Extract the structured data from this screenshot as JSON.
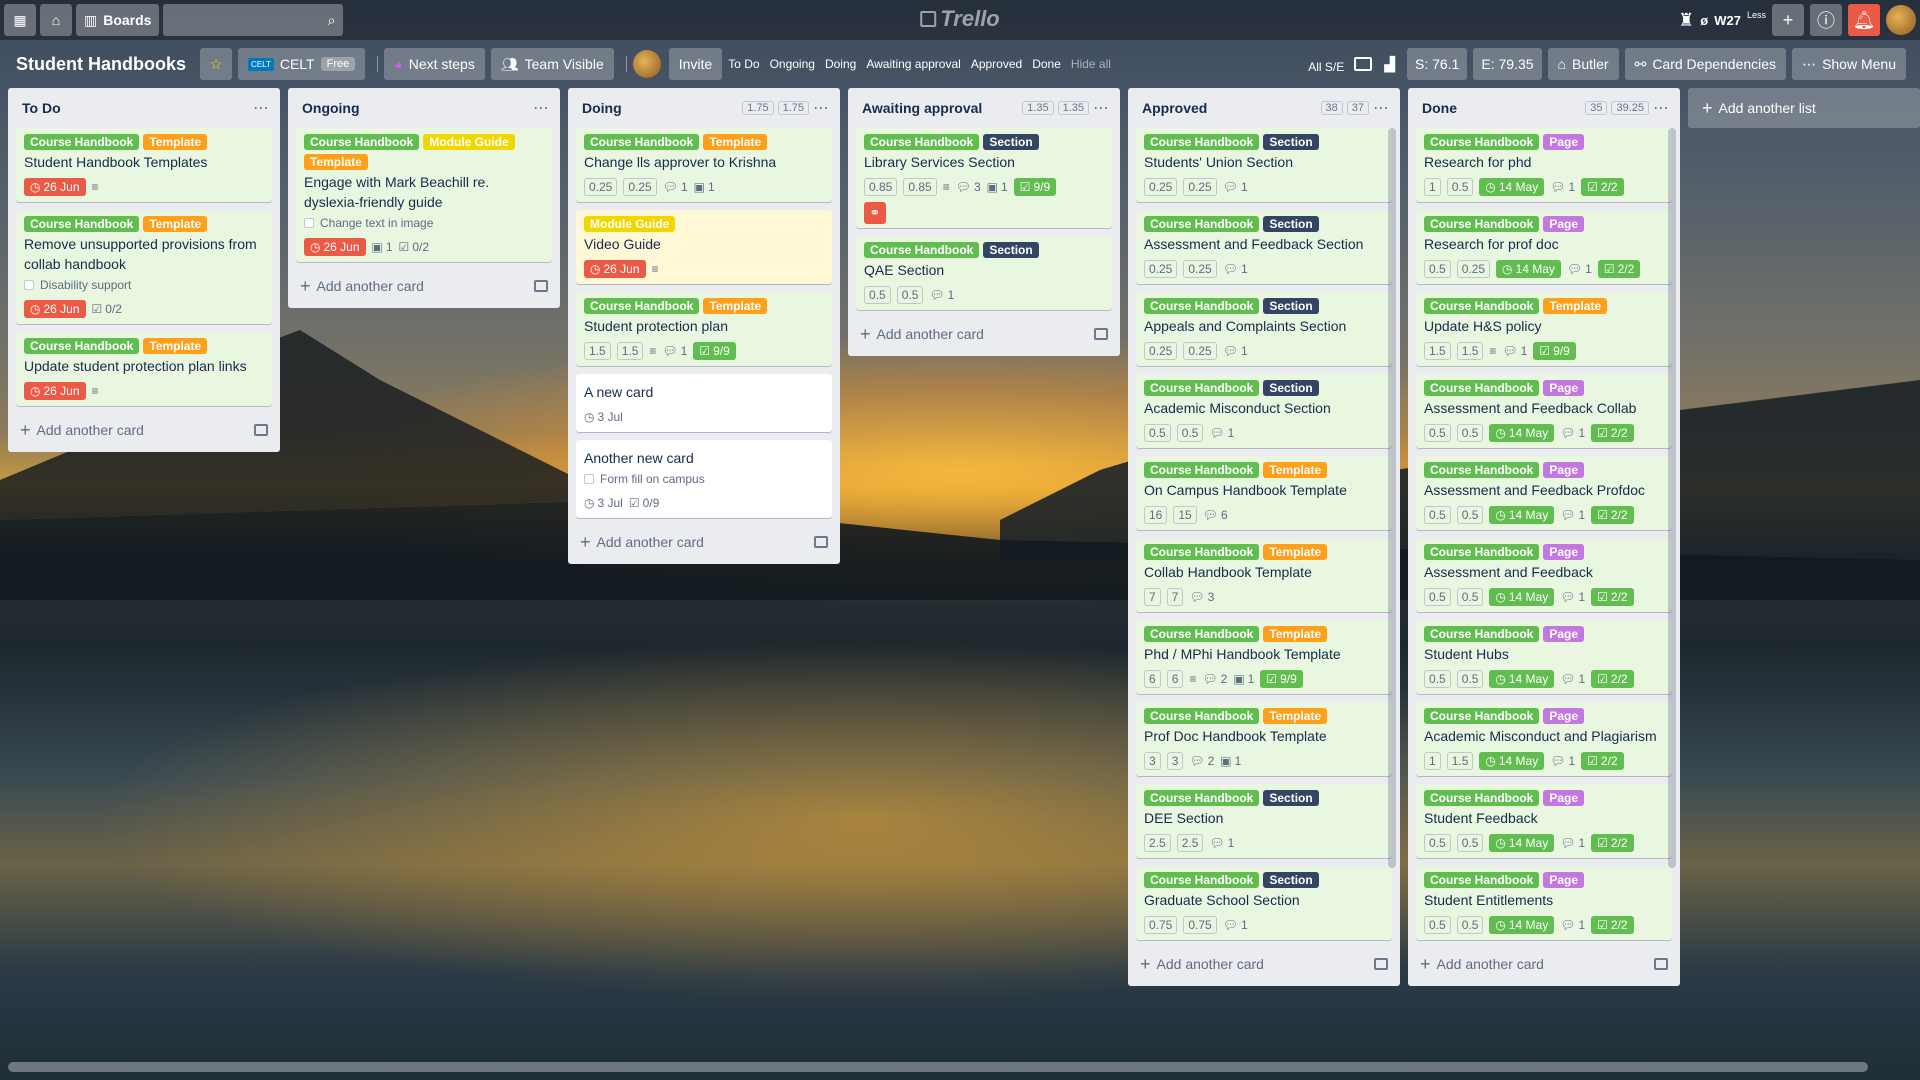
{
  "topnav": {
    "boards_label": "Boards",
    "logo_text": "Trello",
    "week": "W27",
    "week_sup": "Less",
    "slash": "ø"
  },
  "header": {
    "title": "Student Handbooks",
    "team": "CELT",
    "team_plan": "Free",
    "next_steps": "Next steps",
    "visibility": "Team Visible",
    "invite": "Invite",
    "quick_links": [
      "To Do",
      "Ongoing",
      "Doing",
      "Awaiting approval",
      "Approved",
      "Done"
    ],
    "hide_all": "Hide all",
    "all_se": "All S/E",
    "s_value": "S: 76.1",
    "e_value": "E: 79.35",
    "butler": "Butler",
    "card_deps": "Card Dependencies",
    "show_menu": "Show Menu"
  },
  "add_card_label": "Add another card",
  "add_list_label": "Add another list",
  "lists": {
    "todo": {
      "title": "To Do",
      "cards": [
        {
          "labels": [
            "Course Handbook",
            "Template"
          ],
          "title": "Student Handbook Templates",
          "due": "26 Jun"
        },
        {
          "labels": [
            "Course Handbook",
            "Template"
          ],
          "title": "Remove unsupported provisions from collab handbook",
          "checklist_item": "Disability support",
          "due": "26 Jun",
          "checklist": "0/2"
        },
        {
          "labels": [
            "Course Handbook",
            "Template"
          ],
          "title": "Update student protection plan links",
          "due": "26 Jun"
        }
      ]
    },
    "ongoing": {
      "title": "Ongoing",
      "cards": [
        {
          "labels": [
            "Course Handbook",
            "Module Guide",
            "Template"
          ],
          "title": "Engage with Mark Beachill re. dyslexia-friendly guide",
          "checklist_item": "Change text in image",
          "due": "26 Jun",
          "attachments": "1",
          "checklist": "0/2"
        }
      ]
    },
    "doing": {
      "title": "Doing",
      "s": "1.75",
      "e": "1.75",
      "cards": [
        {
          "labels": [
            "Course Handbook",
            "Template"
          ],
          "title": "Change lls approver to Krishna",
          "s": "0.25",
          "e": "0.25",
          "comments": "1",
          "attachments": "1"
        },
        {
          "labels": [
            "Module Guide"
          ],
          "title": "Video Guide",
          "due": "26 Jun"
        },
        {
          "labels": [
            "Course Handbook",
            "Template"
          ],
          "title": "Student protection plan",
          "s": "1.5",
          "e": "1.5",
          "comments": "1",
          "checklist": "9/9"
        },
        {
          "title": "A new card",
          "due": "3 Jul"
        },
        {
          "title": "Another new card",
          "checklist_item": "Form fill on campus",
          "due": "3 Jul",
          "checklist": "0/9"
        }
      ]
    },
    "awaiting": {
      "title": "Awaiting approval",
      "s": "1.35",
      "e": "1.35",
      "cards": [
        {
          "labels": [
            "Course Handbook",
            "Section"
          ],
          "title": "Library Services Section",
          "s": "0.85",
          "e": "0.85",
          "comments": "3",
          "attachments": "1",
          "checklist": "9/9"
        },
        {
          "labels": [
            "Course Handbook",
            "Section"
          ],
          "title": "QAE Section",
          "s": "0.5",
          "e": "0.5",
          "comments": "1"
        }
      ]
    },
    "approved": {
      "title": "Approved",
      "s": "38",
      "e": "37",
      "cards": [
        {
          "labels": [
            "Course Handbook",
            "Section"
          ],
          "title": "Students' Union Section",
          "s": "0.25",
          "e": "0.25",
          "comments": "1"
        },
        {
          "labels": [
            "Course Handbook",
            "Section"
          ],
          "title": "Assessment and Feedback Section",
          "s": "0.25",
          "e": "0.25",
          "comments": "1"
        },
        {
          "labels": [
            "Course Handbook",
            "Section"
          ],
          "title": "Appeals and Complaints Section",
          "s": "0.25",
          "e": "0.25",
          "comments": "1"
        },
        {
          "labels": [
            "Course Handbook",
            "Section"
          ],
          "title": "Academic Misconduct Section",
          "s": "0.5",
          "e": "0.5",
          "comments": "1"
        },
        {
          "labels": [
            "Course Handbook",
            "Template"
          ],
          "title": "On Campus Handbook Template",
          "s": "16",
          "e": "15",
          "comments": "6"
        },
        {
          "labels": [
            "Course Handbook",
            "Template"
          ],
          "title": "Collab Handbook Template",
          "s": "7",
          "e": "7",
          "comments": "3"
        },
        {
          "labels": [
            "Course Handbook",
            "Template"
          ],
          "title": "Phd / MPhi Handbook Template",
          "s": "6",
          "e": "6",
          "comments": "2",
          "attachments": "1",
          "checklist": "9/9"
        },
        {
          "labels": [
            "Course Handbook",
            "Template"
          ],
          "title": "Prof Doc Handbook Template",
          "s": "3",
          "e": "3",
          "comments": "2",
          "attachments": "1"
        },
        {
          "labels": [
            "Course Handbook",
            "Section"
          ],
          "title": "DEE Section",
          "s": "2.5",
          "e": "2.5",
          "comments": "1"
        },
        {
          "labels": [
            "Course Handbook",
            "Section"
          ],
          "title": "Graduate School Section",
          "s": "0.75",
          "e": "0.75",
          "comments": "1"
        }
      ]
    },
    "done": {
      "title": "Done",
      "s": "35",
      "e": "39.25",
      "cards": [
        {
          "labels": [
            "Course Handbook",
            "Page"
          ],
          "title": "Research for phd",
          "s": "1",
          "e": "0.5",
          "due": "14 May",
          "comments": "1",
          "checklist": "2/2"
        },
        {
          "labels": [
            "Course Handbook",
            "Page"
          ],
          "title": "Research for prof doc",
          "s": "0.5",
          "e": "0.25",
          "due": "14 May",
          "comments": "1",
          "checklist": "2/2"
        },
        {
          "labels": [
            "Course Handbook",
            "Template"
          ],
          "title": "Update H&S policy",
          "s": "1.5",
          "e": "1.5",
          "comments": "1",
          "checklist": "9/9"
        },
        {
          "labels": [
            "Course Handbook",
            "Page"
          ],
          "title": "Assessment and Feedback Collab",
          "s": "0.5",
          "e": "0.5",
          "due": "14 May",
          "comments": "1",
          "checklist": "2/2"
        },
        {
          "labels": [
            "Course Handbook",
            "Page"
          ],
          "title": "Assessment and Feedback Profdoc",
          "s": "0.5",
          "e": "0.5",
          "due": "14 May",
          "comments": "1",
          "checklist": "2/2"
        },
        {
          "labels": [
            "Course Handbook",
            "Page"
          ],
          "title": "Assessment and Feedback",
          "s": "0.5",
          "e": "0.5",
          "due": "14 May",
          "comments": "1",
          "checklist": "2/2"
        },
        {
          "labels": [
            "Course Handbook",
            "Page"
          ],
          "title": "Student Hubs",
          "s": "0.5",
          "e": "0.5",
          "due": "14 May",
          "comments": "1",
          "checklist": "2/2"
        },
        {
          "labels": [
            "Course Handbook",
            "Page"
          ],
          "title": "Academic Misconduct and Plagiarism",
          "s": "1",
          "e": "1.5",
          "due": "14 May",
          "comments": "1",
          "checklist": "2/2"
        },
        {
          "labels": [
            "Course Handbook",
            "Page"
          ],
          "title": "Student Feedback",
          "s": "0.5",
          "e": "0.5",
          "due": "14 May",
          "comments": "1",
          "checklist": "2/2"
        },
        {
          "labels": [
            "Course Handbook",
            "Page"
          ],
          "title": "Student Entitlements",
          "s": "0.5",
          "e": "0.5",
          "due": "14 May",
          "comments": "1",
          "checklist": "2/2"
        }
      ]
    }
  }
}
